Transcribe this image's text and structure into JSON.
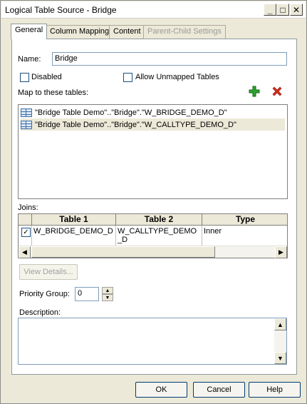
{
  "window": {
    "title": "Logical Table Source - Bridge"
  },
  "titlebar": {
    "minimize": "_",
    "maximize": "□",
    "close": "✕"
  },
  "tabs": [
    {
      "label": "General",
      "state": "active"
    },
    {
      "label": "Column Mapping",
      "state": "normal"
    },
    {
      "label": "Content",
      "state": "normal"
    },
    {
      "label": "Parent-Child Settings",
      "state": "disabled"
    }
  ],
  "general": {
    "name_label": "Name:",
    "name_value": "Bridge",
    "disabled_label": "Disabled",
    "disabled_checked": false,
    "allow_unmapped_label": "Allow Unmapped Tables",
    "allow_unmapped_checked": false,
    "map_label": "Map to these tables:",
    "add_icon": "plus-icon",
    "delete_icon": "x-icon",
    "mapped_tables": [
      "\"Bridge Table Demo\"..\"Bridge\".\"W_BRIDGE_DEMO_D\"",
      "\"Bridge Table Demo\"..\"Bridge\".\"W_CALLTYPE_DEMO_D\""
    ],
    "joins_label": "Joins:",
    "joins_columns": [
      "Table 1",
      "Table 2",
      "Type"
    ],
    "joins_rows": [
      {
        "checked": true,
        "table1": "W_BRIDGE_DEMO_D",
        "table2": "W_CALLTYPE_DEMO_D",
        "type": "Inner"
      }
    ],
    "view_details_label": "View Details...",
    "priority_label": "Priority Group:",
    "priority_value": "0",
    "description_label": "Description:",
    "description_value": ""
  },
  "footer": {
    "ok": "OK",
    "cancel": "Cancel",
    "help": "Help"
  }
}
